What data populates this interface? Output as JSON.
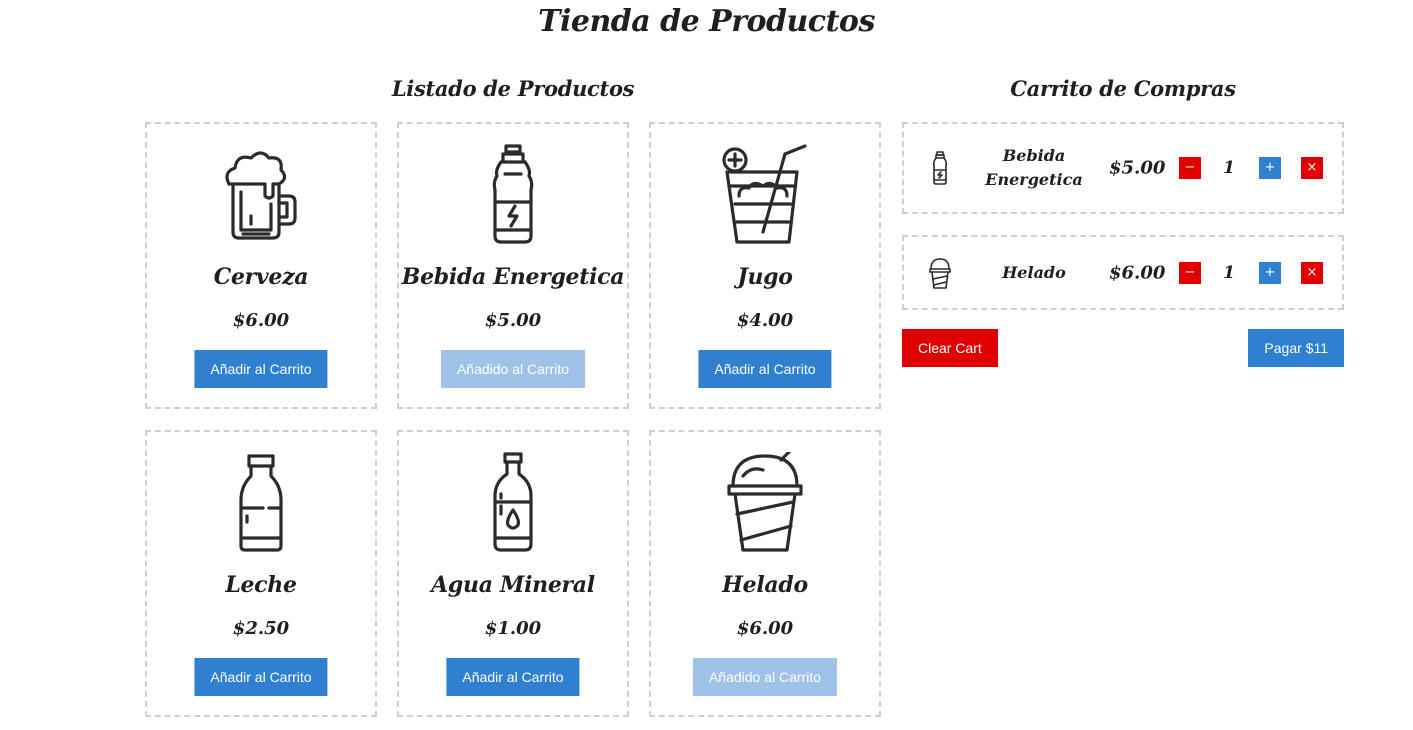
{
  "page": {
    "title": "Tienda de Productos"
  },
  "products_section": {
    "title": "Listado de Productos",
    "items": [
      {
        "name": "Cerveza",
        "price": "$6.00",
        "button": "Añadir al Carrito",
        "added": false,
        "icon": "beer-mug-icon"
      },
      {
        "name": "Bebida Energetica",
        "price": "$5.00",
        "button": "Añadido al Carrito",
        "added": true,
        "icon": "energy-drink-bottle-icon"
      },
      {
        "name": "Jugo",
        "price": "$4.00",
        "button": "Añadir al Carrito",
        "added": false,
        "icon": "juice-glass-icon"
      },
      {
        "name": "Leche",
        "price": "$2.50",
        "button": "Añadir al Carrito",
        "added": false,
        "icon": "milk-bottle-icon"
      },
      {
        "name": "Agua Mineral",
        "price": "$1.00",
        "button": "Añadir al Carrito",
        "added": false,
        "icon": "water-bottle-icon"
      },
      {
        "name": "Helado",
        "price": "$6.00",
        "button": "Añadido al Carrito",
        "added": true,
        "icon": "ice-cream-cup-icon"
      }
    ]
  },
  "cart": {
    "title": "Carrito de Compras",
    "items": [
      {
        "name": "Bebida Energetica",
        "price": "$5.00",
        "quantity": "1",
        "icon": "energy-drink-bottle-icon",
        "decrement": "−",
        "increment": "+",
        "remove": "×"
      },
      {
        "name": "Helado",
        "price": "$6.00",
        "quantity": "1",
        "icon": "ice-cream-cup-icon",
        "decrement": "−",
        "increment": "+",
        "remove": "×"
      }
    ],
    "clear_label": "Clear Cart",
    "pay_label": "Pagar $11"
  },
  "colors": {
    "primary": "#2f80d1",
    "primary_disabled": "#9ec2e8",
    "danger": "#e00000",
    "border": "#cfcfcf"
  }
}
